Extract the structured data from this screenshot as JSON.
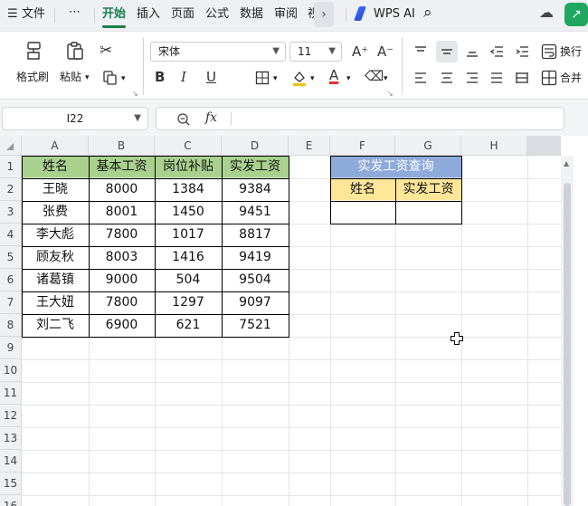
{
  "menu": {
    "hamburger_icon": "☰",
    "file": "文件",
    "more": "⋯",
    "tabs": [
      "开始",
      "插入",
      "页面",
      "公式",
      "数据",
      "审阅",
      "视"
    ],
    "active_tab": "开始",
    "more_tabs": "›",
    "wps_ai": "WPS AI",
    "search_icon": "⌕",
    "cloud_icon": "☁",
    "share_icon": "↗"
  },
  "ribbon": {
    "format_painter": "格式刷",
    "paste": "粘贴",
    "font_name": "宋体",
    "font_size": "11",
    "bold": "B",
    "italic": "I",
    "underline": "U",
    "grow_font": "A⁺",
    "shrink_font": "A⁻",
    "font_color_letter": "A",
    "wrap_text": "换行",
    "merge": "合并"
  },
  "formula": {
    "name_box": "I22",
    "fx_label": "fx",
    "formula_value": ""
  },
  "grid": {
    "columns": [
      "A",
      "B",
      "C",
      "D",
      "E",
      "F",
      "G",
      "H"
    ],
    "rows": [
      "1",
      "2",
      "3",
      "4",
      "5",
      "6",
      "7",
      "8",
      "9",
      "10",
      "11",
      "12",
      "13",
      "14",
      "15",
      "16"
    ],
    "table": {
      "headers": [
        "姓名",
        "基本工资",
        "岗位补贴",
        "实发工资"
      ],
      "rows": [
        [
          "王晓",
          "8000",
          "1384",
          "9384"
        ],
        [
          "张费",
          "8001",
          "1450",
          "9451"
        ],
        [
          "李大彪",
          "7800",
          "1017",
          "8817"
        ],
        [
          "顾友秋",
          "8003",
          "1416",
          "9419"
        ],
        [
          "诸葛镇",
          "9000",
          "504",
          "9504"
        ],
        [
          "王大妞",
          "7800",
          "1297",
          "9097"
        ],
        [
          "刘二飞",
          "6900",
          "621",
          "7521"
        ]
      ]
    },
    "lookup": {
      "title": "实发工资查询",
      "headers": [
        "姓名",
        "实发工资"
      ],
      "name_value": "",
      "salary_value": ""
    }
  },
  "colors": {
    "header_green": "#a9d18e",
    "lookup_title_blue": "#8eaadb",
    "lookup_header_yellow": "#ffe699",
    "accent_green": "#1a7f4b"
  }
}
